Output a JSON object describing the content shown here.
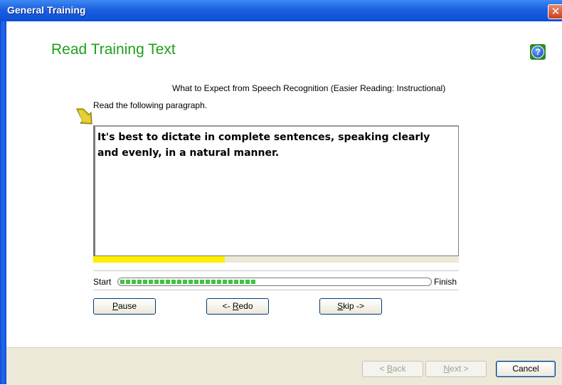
{
  "window": {
    "title": "General Training",
    "close_glyph": "✕"
  },
  "header": {
    "heading": "Read Training Text",
    "help_glyph": "?"
  },
  "subtitle": "What to Expect from Speech Recognition (Easier Reading: Instructional)",
  "instruction": "Read the following paragraph.",
  "paragraph": "It's best to dictate in complete sentences, speaking clearly and evenly, in a natural manner.",
  "reading_progress": 0.36,
  "overall_progress": {
    "start_label": "Start",
    "finish_label": "Finish",
    "value": 0.44
  },
  "controls": {
    "pause": {
      "prefix": "",
      "mnemonic": "P",
      "rest": "ause"
    },
    "redo": {
      "prefix": "<- ",
      "mnemonic": "R",
      "rest": "edo"
    },
    "skip": {
      "prefix": "",
      "mnemonic": "S",
      "rest": "kip ->"
    }
  },
  "footer": {
    "back": {
      "prefix": "< ",
      "mnemonic": "B",
      "rest": "ack"
    },
    "next": {
      "prefix": "",
      "mnemonic": "N",
      "rest": "ext >"
    },
    "cancel": "Cancel"
  },
  "colors": {
    "heading": "#1ea01e",
    "title_bar": "#0b4fd8",
    "reading_bar": "#ffee00",
    "progress_fill": "#3fc43f",
    "pointer_arrow": "#c8b400"
  },
  "icons": {
    "help": "help-icon",
    "pointer": "pointer-arrow-icon",
    "close": "close-icon"
  }
}
